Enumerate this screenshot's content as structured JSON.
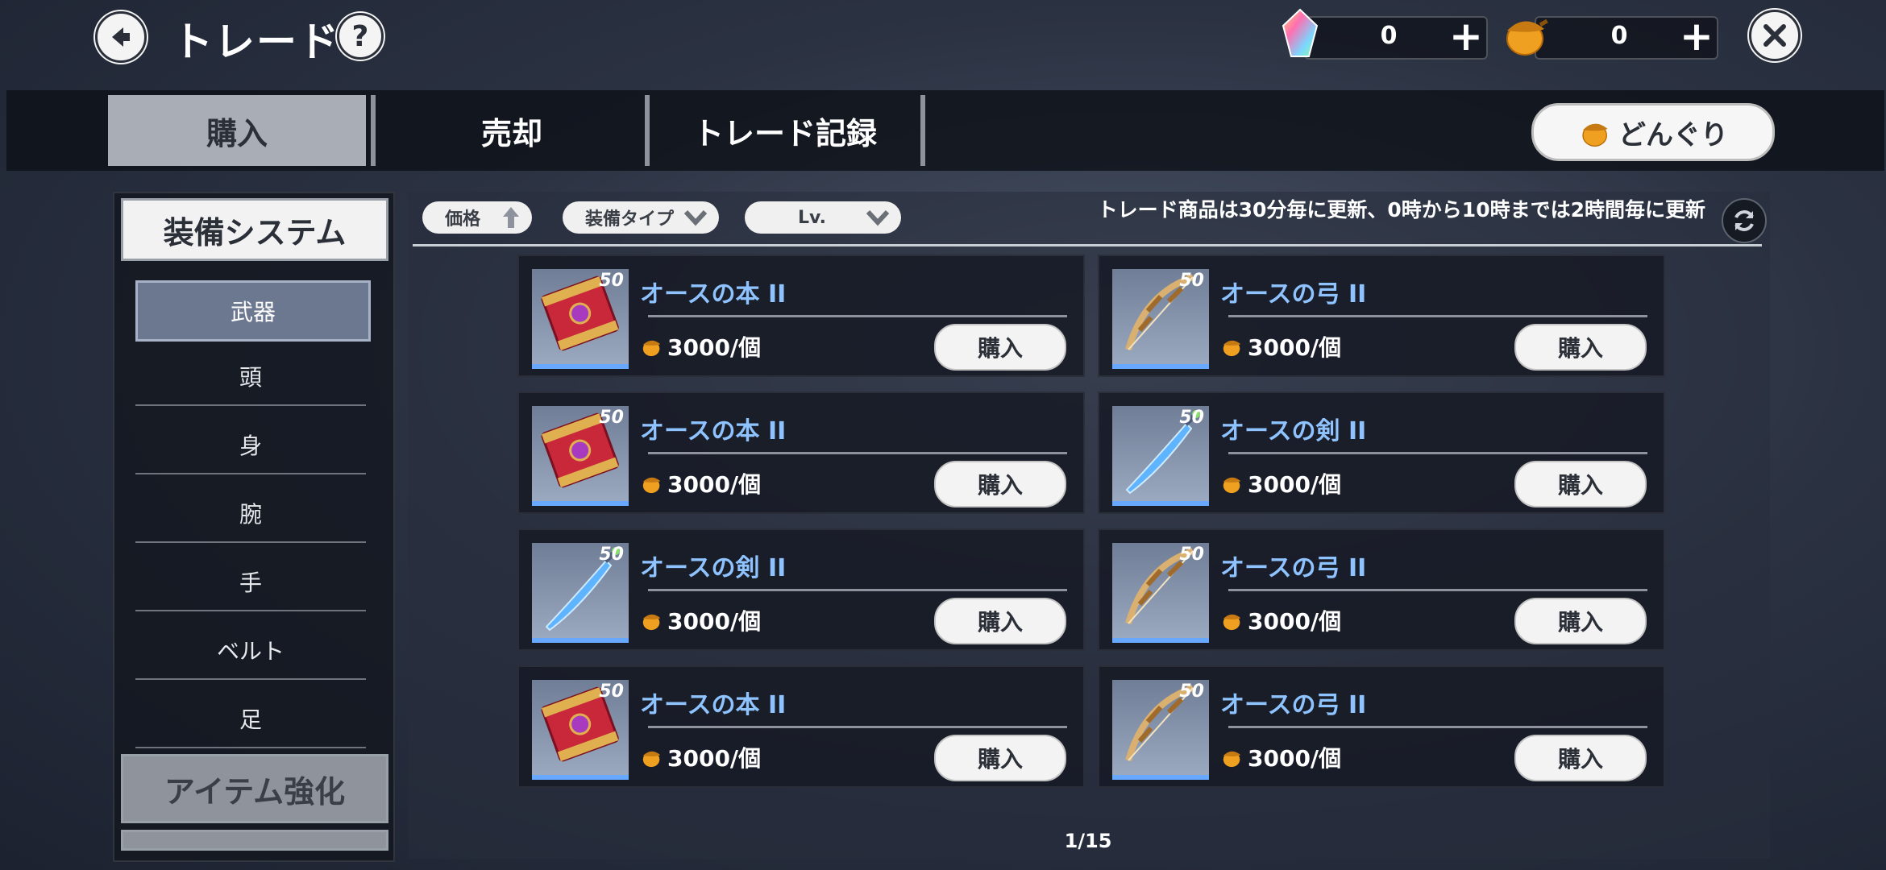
{
  "header": {
    "title": "トレード",
    "help_glyph": "?",
    "currency_crystal": "0",
    "currency_acorn": "0",
    "plus_glyph": "+"
  },
  "tabs": [
    {
      "label": "購入",
      "active": true
    },
    {
      "label": "売却",
      "active": false
    },
    {
      "label": "トレード記録",
      "active": false
    }
  ],
  "acorn_button": "どんぐり",
  "sidebar": {
    "section_main": "装備システム",
    "items": [
      {
        "label": "武器",
        "active": true
      },
      {
        "label": "頭",
        "active": false
      },
      {
        "label": "身",
        "active": false
      },
      {
        "label": "腕",
        "active": false
      },
      {
        "label": "手",
        "active": false
      },
      {
        "label": "ベルト",
        "active": false
      },
      {
        "label": "足",
        "active": false
      }
    ],
    "section_second": "アイテム強化"
  },
  "filters": {
    "price": "価格",
    "equip_type": "装備タイプ",
    "level": "Lv."
  },
  "notice": "トレード商品は30分毎に更新、0時から10時までは2時間毎に更新",
  "items": [
    {
      "name": "オースの本 II",
      "level": "50",
      "price": "3000/個",
      "buy": "購入",
      "kind": "book"
    },
    {
      "name": "オースの弓 II",
      "level": "50",
      "price": "3000/個",
      "buy": "購入",
      "kind": "bow"
    },
    {
      "name": "オースの本 II",
      "level": "50",
      "price": "3000/個",
      "buy": "購入",
      "kind": "book"
    },
    {
      "name": "オースの剣 II",
      "level": "50",
      "price": "3000/個",
      "buy": "購入",
      "kind": "sword"
    },
    {
      "name": "オースの剣 II",
      "level": "50",
      "price": "3000/個",
      "buy": "購入",
      "kind": "sword"
    },
    {
      "name": "オースの弓 II",
      "level": "50",
      "price": "3000/個",
      "buy": "購入",
      "kind": "bow"
    },
    {
      "name": "オースの本 II",
      "level": "50",
      "price": "3000/個",
      "buy": "購入",
      "kind": "book"
    },
    {
      "name": "オースの弓 II",
      "level": "50",
      "price": "3000/個",
      "buy": "購入",
      "kind": "bow"
    }
  ],
  "pager": "1/15",
  "colors": {
    "item_name": "#8fc3ff",
    "accent_blue": "#69a8ff",
    "acorn": "#f0a020"
  }
}
